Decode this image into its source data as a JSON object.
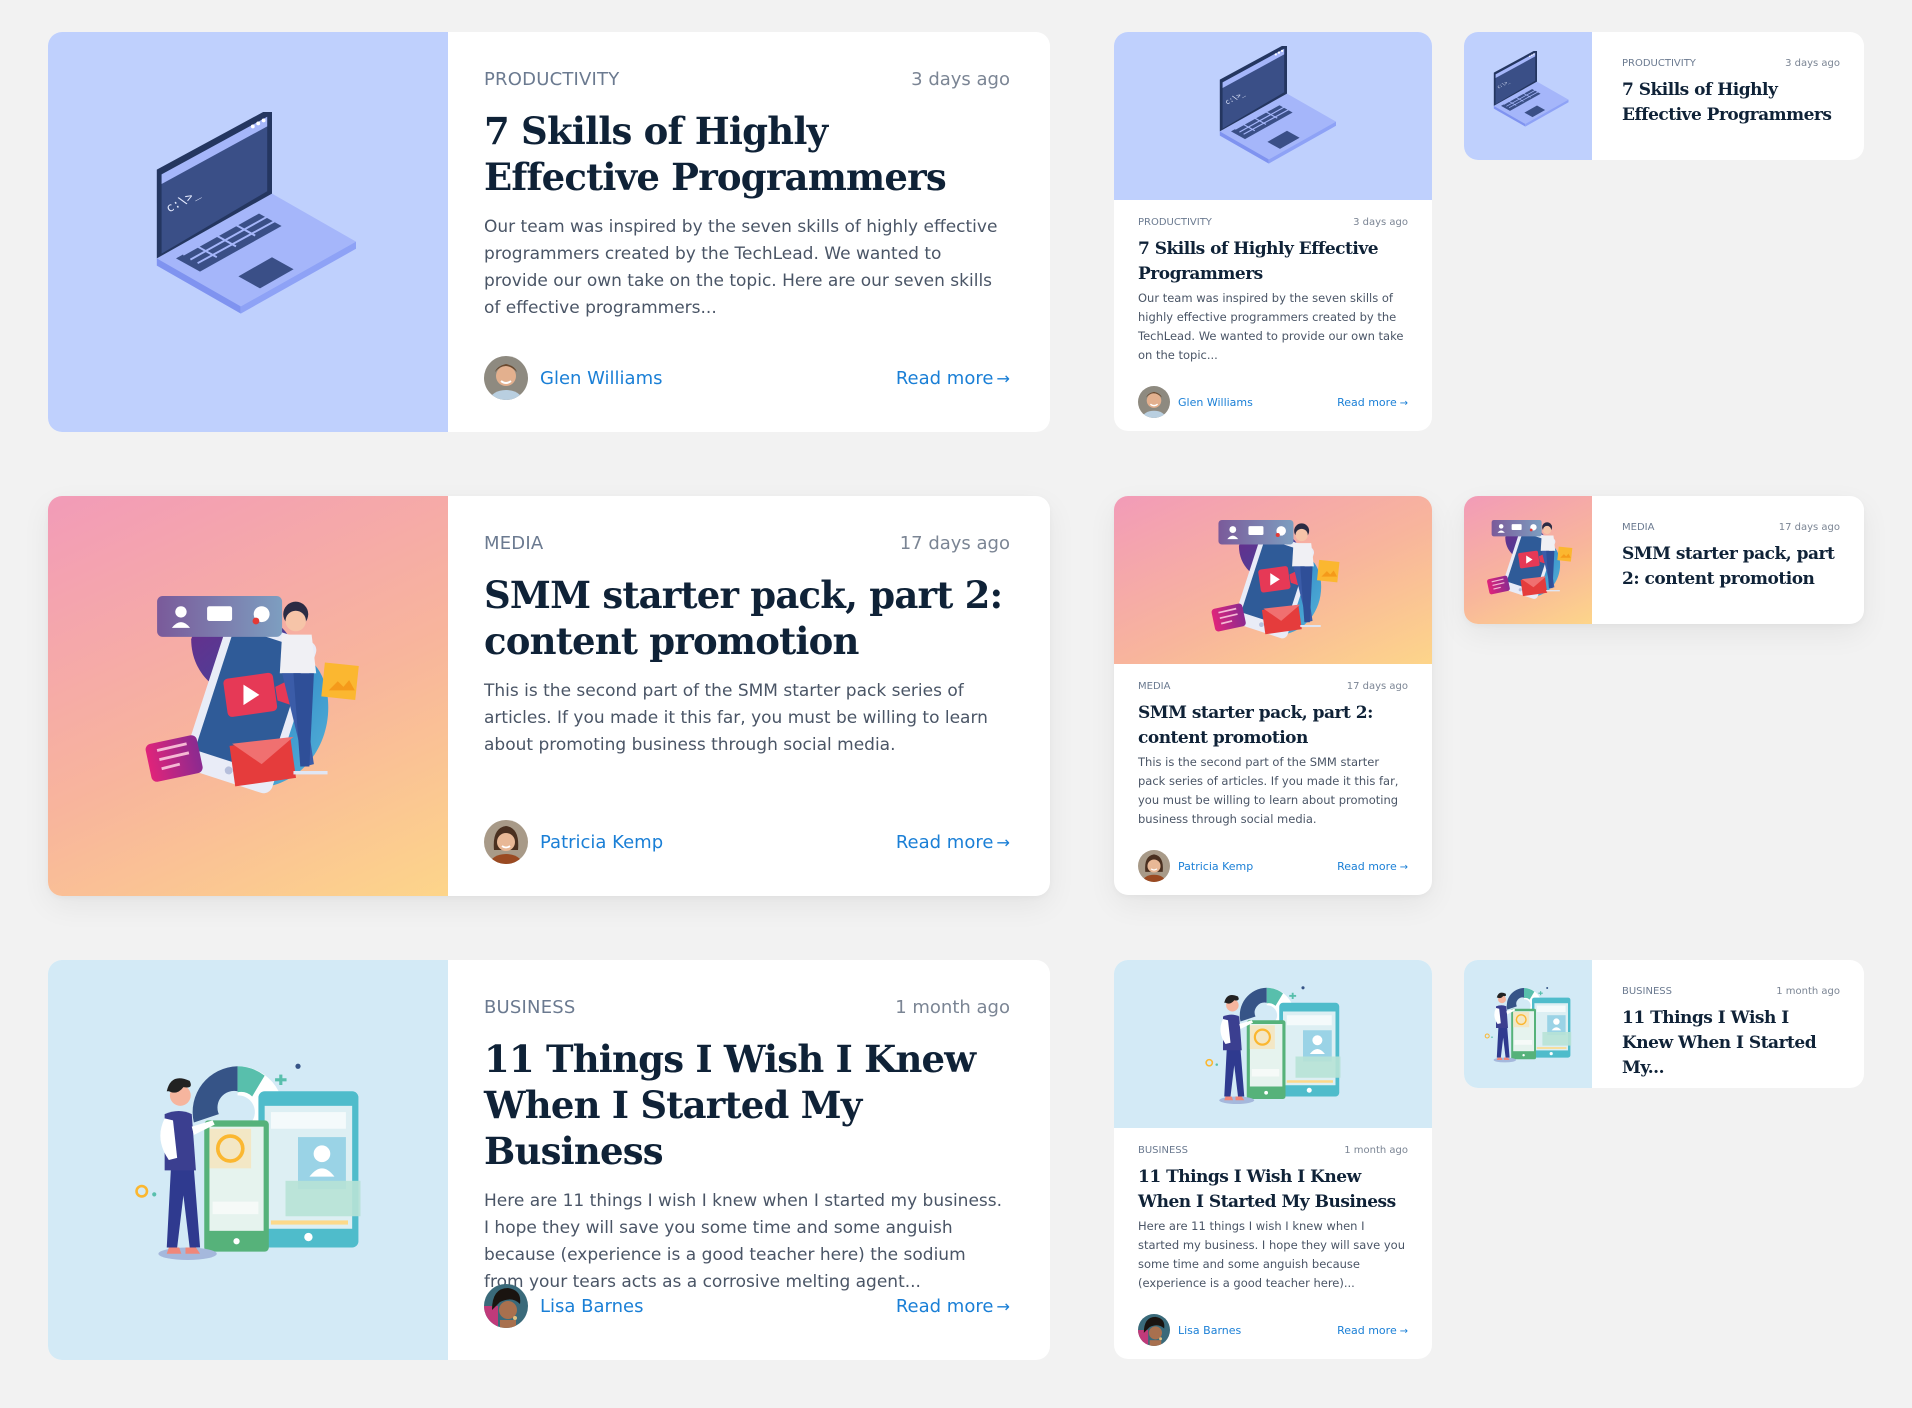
{
  "colors": {
    "page_background": "#f2f2f2",
    "card_background": "#ffffff",
    "link": "#1a7fd6",
    "title": "#0f2237",
    "category": "#6b7a90",
    "body_text": "#4a5566",
    "productivity_bg": "#bfd0fd",
    "media_bg_gradient": [
      "#f29bb8",
      "#fdd58a"
    ],
    "business_bg": "#d3eaf6"
  },
  "read_more_label": "Read more",
  "read_more_icon": "arrow-right-icon",
  "articles": [
    {
      "category": "Productivity",
      "date": "3 days ago",
      "title": "7 Skills of Highly Effective Programmers",
      "excerpt_large": "Our team was inspired by the seven skills of highly effective programmers created by the TechLead. We wanted to provide our own take on the topic. Here are our seven skills of effective programmers...",
      "excerpt_medium": "Our team was inspired by the seven skills of highly effective programmers created by the TechLead. We wanted to provide our own take on the topic...",
      "title_small": "7 Skills of Highly Effective Programmers",
      "author": "Glen Williams",
      "illustration": "laptop-illustration"
    },
    {
      "category": "Media",
      "date": "17 days ago",
      "title": "SMM starter pack, part 2: content promotion",
      "excerpt_large": "This is the second part of the SMM starter pack series of articles. If you made it this far, you must be willing to learn about promoting business through social media.",
      "excerpt_medium": "This is the second part of the SMM starter pack series of articles. If you made it this far, you must be willing to learn about promoting business through social media.",
      "title_small": "SMM starter pack, part 2: content promotion",
      "author": "Patricia Kemp",
      "illustration": "social-media-illustration"
    },
    {
      "category": "Business",
      "date": "1 month ago",
      "title": "11 Things I Wish I Knew When I Started My Business",
      "excerpt_large": "Here are 11 things I wish I knew when I started my business. I hope they will save you some time and some anguish because (experience is a good teacher here) the sodium from your tears acts as a corrosive melting agent...",
      "excerpt_medium": "Here are 11 things I wish I knew when I started my business. I hope they will save you some time and some anguish because (experience is a good teacher here)...",
      "title_small": "11 Things I Wish I Knew When I Started My...",
      "author": "Lisa Barnes",
      "illustration": "business-dashboard-illustration"
    }
  ]
}
